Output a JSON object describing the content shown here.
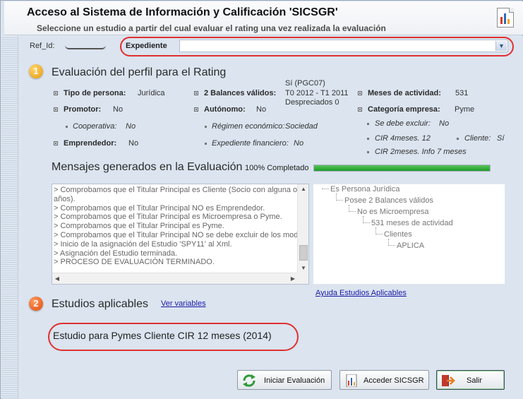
{
  "header": {
    "title": "Acceso al Sistema de Información y Calificación 'SICSGR'",
    "subtitle": "Seleccione un estudio a partir del cual evaluar el rating una vez realizada la evaluación",
    "report_icon": "report-chart-icon"
  },
  "filters": {
    "ref_label": "Ref_Id:",
    "ref_value": "",
    "expediente_label": "Expediente",
    "expediente_value": ""
  },
  "section1": {
    "number": "1",
    "title": "Evaluación del perfil para el Rating",
    "tipo_persona": {
      "label": "Tipo de persona:",
      "value": "Jurídica"
    },
    "balances": {
      "label": "2 Balances válidos:",
      "line1": "Sí (PGC07)",
      "line2": "T0 2012 - T1 2011",
      "line3": "Despreciados 0"
    },
    "meses_actividad": {
      "label": "Meses de actividad:",
      "value": "531"
    },
    "promotor": {
      "label": "Promotor:",
      "value": "No"
    },
    "autonomo": {
      "label": "Autónomo:",
      "value": "No"
    },
    "categoria": {
      "label": "Categoría empresa:",
      "value": "Pyme"
    },
    "se_debe_excluir": {
      "label": "Se debe excluir:",
      "value": "No"
    },
    "cooperativa": {
      "label": "Cooperativa:",
      "value": "No"
    },
    "regimen": {
      "label": "Régimen económico:",
      "value": "Sociedad"
    },
    "cir4": "CIR 4meses. 12",
    "cliente": {
      "label": "Cliente:",
      "value": "Sí"
    },
    "emprendedor": {
      "label": "Emprendedor:",
      "value": "No"
    },
    "expediente_financiero": {
      "label": "Expediente financiero:",
      "value": "No"
    },
    "cir2": "CIR 2meses. Info 7 meses"
  },
  "messages": {
    "title": "Mensajes generados en la Evaluación",
    "progress_label": "100% Completado",
    "progress": 1.0,
    "lines": [
      "> Comprobamos que el Titular Principal es Cliente (Socio con alguna oper",
      "años).",
      "> Comprobamos que el Titular Principal NO es Emprendedor.",
      "> Comprobamos que el Titular Principal es Microempresa o Pyme.",
      "> Comprobamos que el Titular Principal es Pyme.",
      "> Comprobamos que el Titular Principal NO se debe excluir de los modelos",
      "> Inicio de la asignación del Estudio 'SPY11' al Xml.",
      "> Asignación del Estudio terminada.",
      "> PROCESO DE EVALUACIÓN TERMINADO."
    ]
  },
  "tree": [
    "Es Persona Jurídica",
    "Posee 2 Balances válidos",
    "No es Microempresa",
    "531 meses de actividad",
    "Clientes",
    "APLICA"
  ],
  "help_link": "Ayuda Estudios Aplicables",
  "section2": {
    "number": "2",
    "title": "Estudios aplicables",
    "ver_variables": "Ver variables",
    "estudio": "Estudio para Pymes Cliente CIR 12 meses (2014)"
  },
  "buttons": {
    "iniciar": "Iniciar Evaluación",
    "acceder": "Acceder SICSGR",
    "salir": "Salir"
  },
  "colors": {
    "accent_red": "#e03030",
    "progress_green": "#1f9a2a",
    "background": "#dbe4ef"
  }
}
